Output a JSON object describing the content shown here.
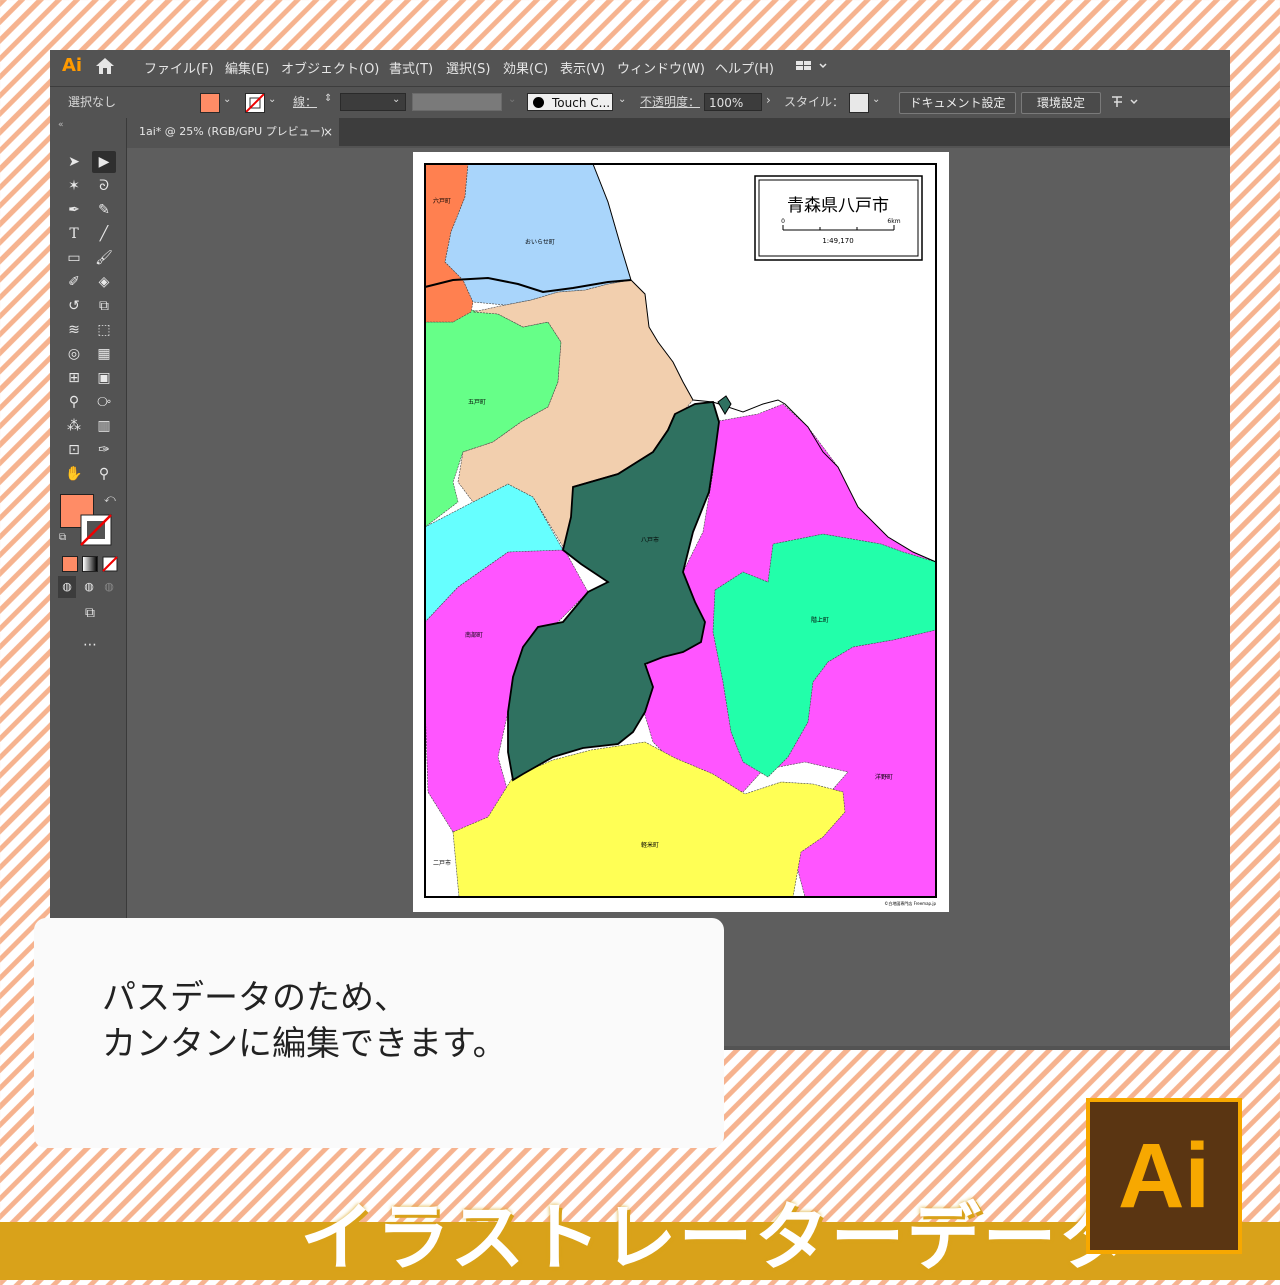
{
  "menubar": {
    "app_logo": "Ai",
    "items": [
      "ファイル(F)",
      "編集(E)",
      "オブジェクト(O)",
      "書式(T)",
      "選択(S)",
      "効果(C)",
      "表示(V)",
      "ウィンドウ(W)",
      "ヘルプ(H)"
    ]
  },
  "controlbar": {
    "selection": "選択なし",
    "stroke_label": "線：",
    "brush": "Touch C...",
    "opacity_label": "不透明度：",
    "opacity_value": "100%",
    "style_label": "スタイル：",
    "doc_settings": "ドキュメント設定",
    "prefs": "環境設定",
    "fill_color": "#ff8c66"
  },
  "tab": {
    "label": "1ai* @ 25% (RGB/GPU プレビュー)",
    "close": "×"
  },
  "map": {
    "title": "青森県八戸市",
    "scale_start": "0",
    "scale_end": "6km",
    "scale": "1:49,170",
    "credit": "©白地図専門店 Freemap.jp",
    "labels": {
      "rokunohe": "六戸町",
      "oirase": "おいらせ町",
      "gonohe": "五戸町",
      "hachinohe": "八戸市",
      "nanbu": "南部町",
      "hashikami": "階上町",
      "karumai": "軽米町",
      "hirono": "洋野町",
      "ninohe": "二戸市"
    },
    "colors": {
      "oirase": "#a9d5fb",
      "rokunohe": "#ff8050",
      "gonohe": "#66ff88",
      "hachinohe": "#2f7160",
      "peach": "#f2cfae",
      "cyan": "#66ffff",
      "magenta": "#ff55ff",
      "hashikami": "#22ffaa",
      "karumai": "#ffff55"
    }
  },
  "note": {
    "line1": "パスデータのため、",
    "line2": "カンタンに編集できます。"
  },
  "banner": {
    "text": "イラストレーターデータ"
  },
  "logo": {
    "text": "Ai"
  }
}
